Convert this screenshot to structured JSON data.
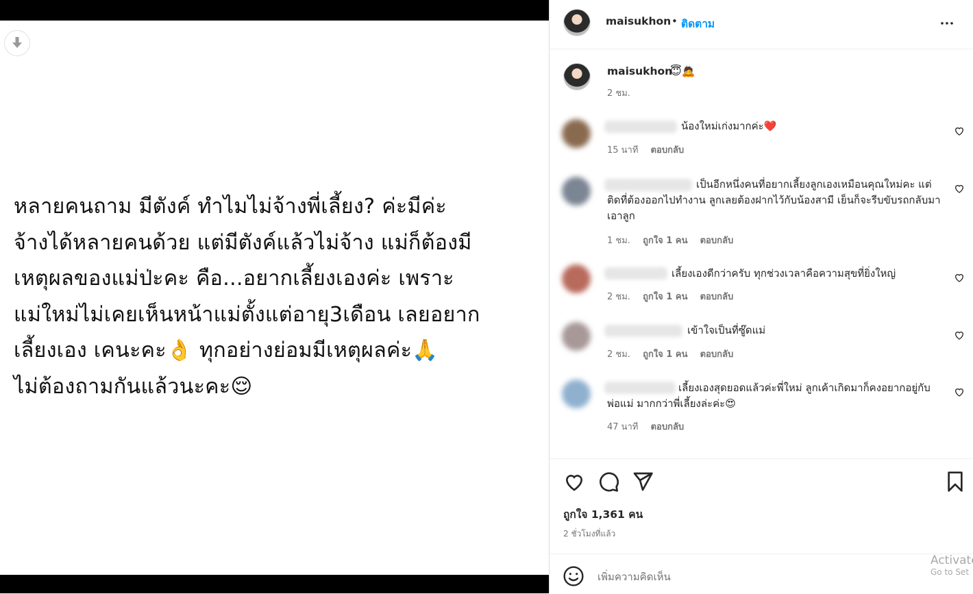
{
  "post_image": {
    "text": "หลายคนถาม มีตังค์ ทำไมไม่จ้างพี่เลี้ยง? ค่ะมีค่ะ\nจ้างได้หลายคนด้วย แต่มีตังค์แล้วไม่จ้าง แม่ก็ต้องมี\nเหตุผลของแม่ป่ะคะ คือ...อยากเลี้ยงเองค่ะ เพราะ\nแม่ใหม่ไม่เคยเห็นหน้าแม่ตั้งแต่อายุ3เดือน เลยอยาก\nเลี้ยงเอง เคนะคะ👌 ทุกอย่างย่อมมีเหตุผลค่ะ🙏\nไม่ต้องถามกันแล้วนะคะ😌"
  },
  "header": {
    "username": "maisukhon",
    "dot": "•",
    "follow_label": "ติดตาม"
  },
  "caption": {
    "username": "maisukhon",
    "text": "😇🙇",
    "time": "2 ชม."
  },
  "comments": [
    {
      "text": "น้องใหม่เก่งมากค่ะ❤️",
      "time": "15 นาที",
      "likes": "",
      "reply": "ตอบกลับ",
      "avatar_color": "#8a6a4f"
    },
    {
      "text": "เป็นอีกหนึ่งคนที่อยากเลี้ยงลูกเองเหมือนคุณใหม่คะ แต่ติดที่ต้องออกไปทำงาน ลูกเลยต้องฝากไว้กับน้องสามี เย็นก็จะรีบขับรถกลับมาเอาลูก",
      "time": "1 ชม.",
      "likes": "ถูกใจ 1 คน",
      "reply": "ตอบกลับ",
      "avatar_color": "#7b8593"
    },
    {
      "text": "เลี้ยงเองดีกว่าครับ ทุกช่วงเวลาคือความสุขที่ยิ่งใหญ่",
      "time": "2 ชม.",
      "likes": "ถูกใจ 1 คน",
      "reply": "ตอบกลับ",
      "avatar_color": "#b86a5c"
    },
    {
      "text": "เข้าใจเป็นที่ซู๊ดแม่",
      "time": "2 ชม.",
      "likes": "ถูกใจ 1 คน",
      "reply": "ตอบกลับ",
      "avatar_color": "#a89898"
    },
    {
      "text": "เลี้ยงเองสุดยอดแล้วค่ะพี่ใหม่ ลูกเค้าเกิดมาก็คงอยากอยู่กับพ่อแม่ มากกว่าพี่เลี้ยงล่ะค่ะ😍",
      "time": "47 นาที",
      "likes": "",
      "reply": "ตอบกลับ",
      "avatar_color": "#8fb0cf"
    }
  ],
  "stats": {
    "likes": "ถูกใจ 1,361 คน",
    "posted": "2 ชั่วโมงที่แล้ว"
  },
  "comment_box": {
    "placeholder": "เพิ่มความคิดเห็น"
  },
  "watermark": {
    "line1": "Activate",
    "line2": "Go to Set"
  },
  "icons": {
    "download": "download-arrow-icon",
    "more": "more-horizontal-icon",
    "like": "heart-icon",
    "comment": "comment-bubble-icon",
    "share": "paper-plane-icon",
    "save": "bookmark-icon",
    "emoji": "smiley-icon"
  }
}
